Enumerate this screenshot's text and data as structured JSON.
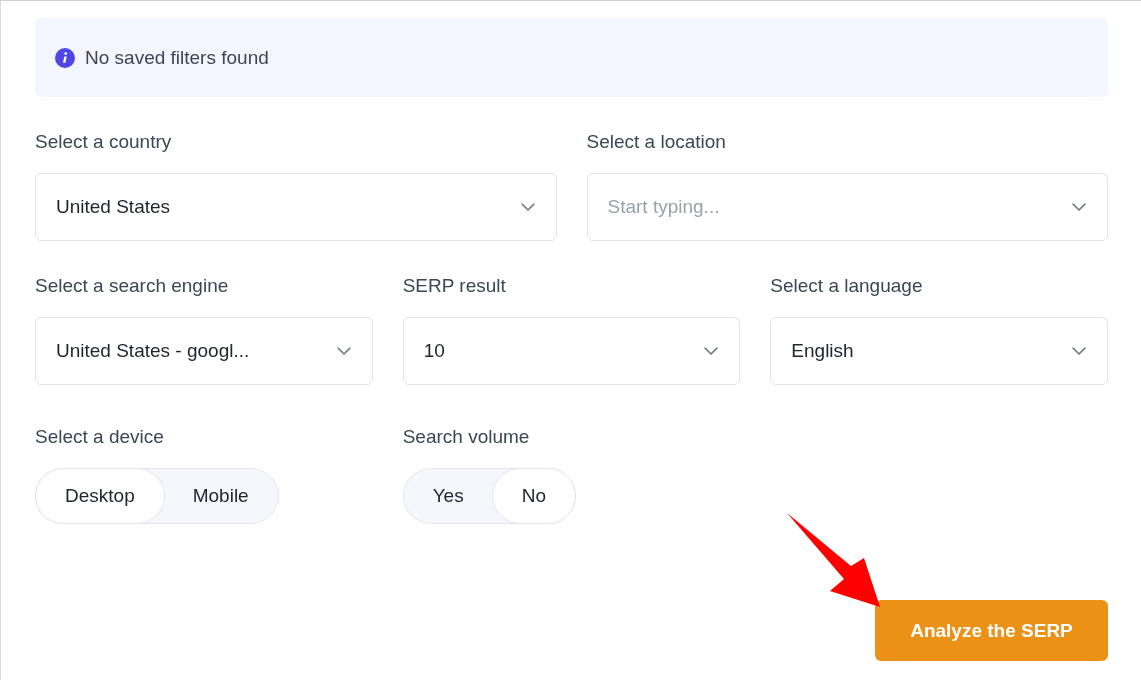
{
  "notice": {
    "text": "No saved filters found"
  },
  "filter_rows": [
    [
      {
        "label": "Select a country",
        "value": "United States"
      },
      {
        "label": "Select a location",
        "placeholder": "Start typing..."
      }
    ],
    [
      {
        "label": "Select a search engine",
        "value": "United States - googl..."
      },
      {
        "label": "SERP result",
        "value": "10"
      },
      {
        "label": "Select a language",
        "value": "English"
      }
    ]
  ],
  "toggles": [
    {
      "label": "Select a device",
      "options": [
        {
          "label": "Desktop",
          "selected": true
        },
        {
          "label": "Mobile",
          "selected": false
        }
      ]
    },
    {
      "label": "Search volume",
      "options": [
        {
          "label": "Yes",
          "selected": false
        },
        {
          "label": "No",
          "selected": true
        }
      ]
    }
  ],
  "submit_button": {
    "label": "Analyze the SERP"
  }
}
